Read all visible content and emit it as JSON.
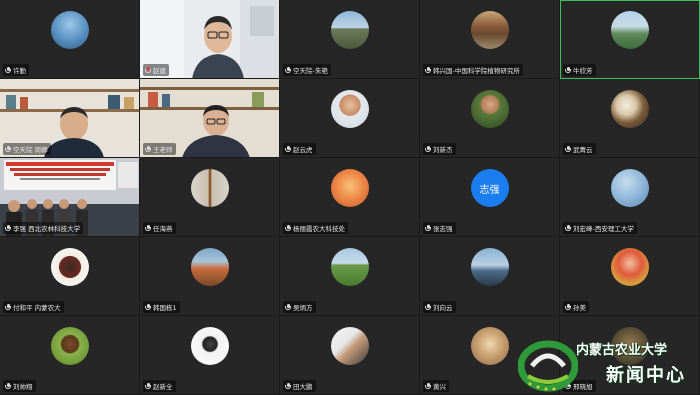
{
  "tiles": [
    {
      "name": "许勤",
      "mic": "on"
    },
    {
      "name": "赵建",
      "mic": "off"
    },
    {
      "name": "空天院-朱艳",
      "mic": "on"
    },
    {
      "name": "韩兴国-中国科学院植物研究所",
      "mic": "on"
    },
    {
      "name": "牛欣芳",
      "mic": "on"
    },
    {
      "name": "空天院 周卿",
      "mic": "on"
    },
    {
      "name": "王老师",
      "mic": "on"
    },
    {
      "name": "赵云虎",
      "mic": "on"
    },
    {
      "name": "刘新杰",
      "mic": "on"
    },
    {
      "name": "武菁云",
      "mic": "on"
    },
    {
      "name": "李强 西北农林科技大学",
      "mic": "on"
    },
    {
      "name": "任海燕",
      "mic": "on"
    },
    {
      "name": "杨丽霞农大科技处",
      "mic": "on"
    },
    {
      "name": "张志强",
      "mic": "on",
      "avatar_text": "志强"
    },
    {
      "name": "刘宏峰-西安理工大学",
      "mic": "on"
    },
    {
      "name": "付和平 内蒙农大",
      "mic": "on"
    },
    {
      "name": "韩国栋1",
      "mic": "on"
    },
    {
      "name": "吴炳方",
      "mic": "on"
    },
    {
      "name": "刘向云",
      "mic": "on"
    },
    {
      "name": "孙美",
      "mic": "on"
    },
    {
      "name": "刘帅翔",
      "mic": "on"
    },
    {
      "name": "赵新全",
      "mic": "on"
    },
    {
      "name": "田大鹏",
      "mic": "on"
    },
    {
      "name": "黄兴",
      "mic": "on"
    },
    {
      "name": "邢晓旭",
      "mic": "on"
    }
  ],
  "logo": {
    "line1": "内蒙古农业大学",
    "line2": "新闻中心"
  },
  "colors": {
    "active_border": "#3fbf5a",
    "text_avatar": "#1a7ef0"
  }
}
